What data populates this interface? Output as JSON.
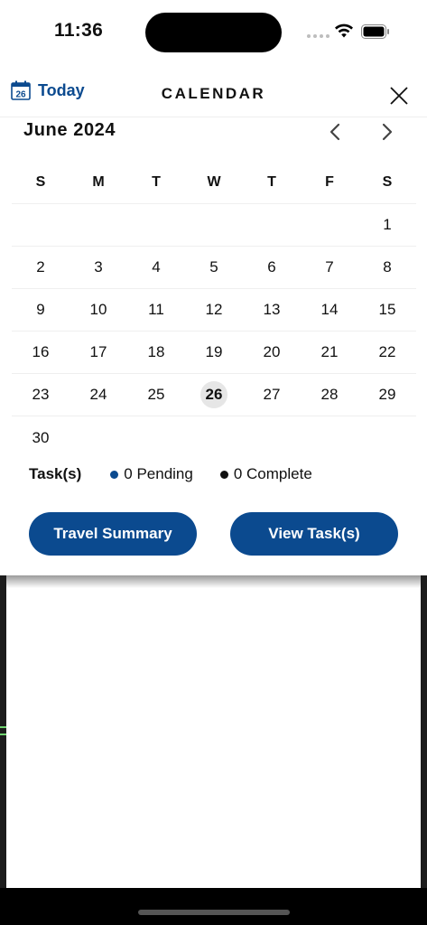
{
  "status_bar": {
    "time": "11:36",
    "icons": [
      "signal-dots-icon",
      "wifi-icon",
      "battery-icon"
    ]
  },
  "header": {
    "today_icon": "calendar-26-icon",
    "today_icon_number": "26",
    "today_label": "Today",
    "title": "CALENDAR",
    "close_icon": "close-icon"
  },
  "calendar": {
    "month_label": "June 2024",
    "prev_icon": "chevron-left-icon",
    "next_icon": "chevron-right-icon",
    "weekdays": [
      "S",
      "M",
      "T",
      "W",
      "T",
      "F",
      "S"
    ],
    "weeks": [
      [
        "",
        "",
        "",
        "",
        "",
        "",
        "1"
      ],
      [
        "2",
        "3",
        "4",
        "5",
        "6",
        "7",
        "8"
      ],
      [
        "9",
        "10",
        "11",
        "12",
        "13",
        "14",
        "15"
      ],
      [
        "16",
        "17",
        "18",
        "19",
        "20",
        "21",
        "22"
      ],
      [
        "23",
        "24",
        "25",
        "26",
        "27",
        "28",
        "29"
      ],
      [
        "30",
        "",
        "",
        "",
        "",
        "",
        ""
      ]
    ],
    "selected_day": "26"
  },
  "tasks": {
    "label": "Task(s)",
    "pending": "0 Pending",
    "complete": "0 Complete",
    "pending_color": "#0b4a8f",
    "complete_color": "#111111"
  },
  "buttons": {
    "travel_summary": "Travel Summary",
    "view_tasks": "View Task(s)"
  },
  "colors": {
    "accent": "#0b4a8f",
    "selected_day_bg": "#e6e6e6"
  }
}
